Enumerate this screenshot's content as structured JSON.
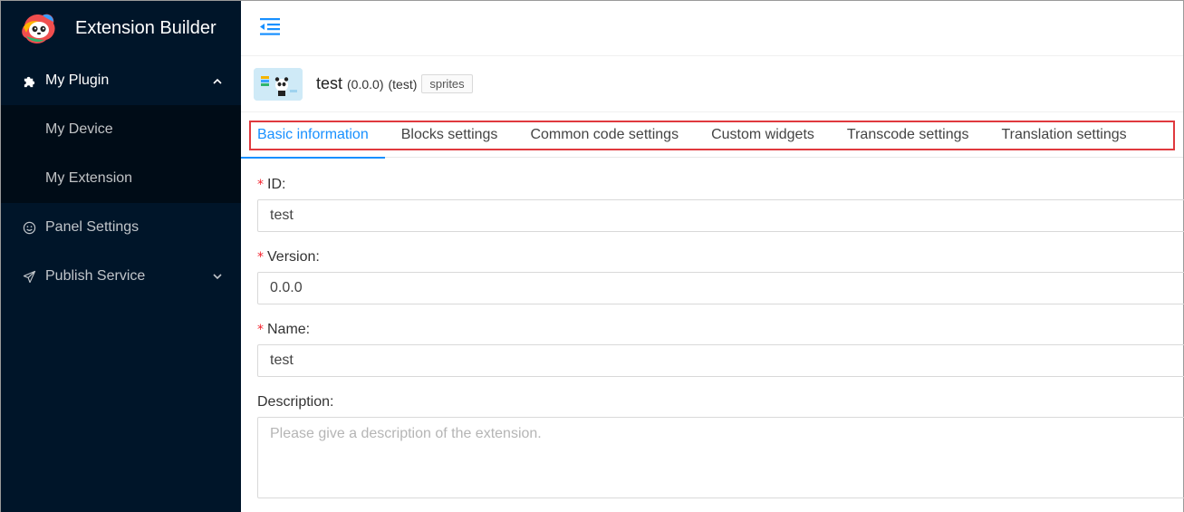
{
  "app": {
    "title": "Extension Builder"
  },
  "sidebar": {
    "items": [
      {
        "label": "My Plugin",
        "icon": "puzzle-icon",
        "expanded": true
      },
      {
        "label": "My Device"
      },
      {
        "label": "My Extension"
      },
      {
        "label": "Panel Settings",
        "icon": "smile-icon"
      },
      {
        "label": "Publish Service",
        "icon": "send-icon"
      }
    ]
  },
  "header": {
    "name": "test",
    "version": "(0.0.0)",
    "id_paren": "(test)",
    "tag": "sprites"
  },
  "tabs": [
    {
      "label": "Basic information",
      "active": true
    },
    {
      "label": "Blocks settings"
    },
    {
      "label": "Common code settings"
    },
    {
      "label": "Custom widgets"
    },
    {
      "label": "Transcode settings"
    },
    {
      "label": "Translation settings"
    }
  ],
  "form": {
    "id": {
      "label": "ID:",
      "value": "test",
      "required": "*"
    },
    "version": {
      "label": "Version:",
      "value": "0.0.0",
      "required": "*"
    },
    "name": {
      "label": "Name:",
      "value": "test",
      "required": "*"
    },
    "description": {
      "label": "Description:",
      "placeholder": "Please give a description of the extension."
    }
  },
  "colors": {
    "sidebar_bg": "#001529",
    "accent": "#1890ff",
    "highlight_box": "#e0393e"
  }
}
